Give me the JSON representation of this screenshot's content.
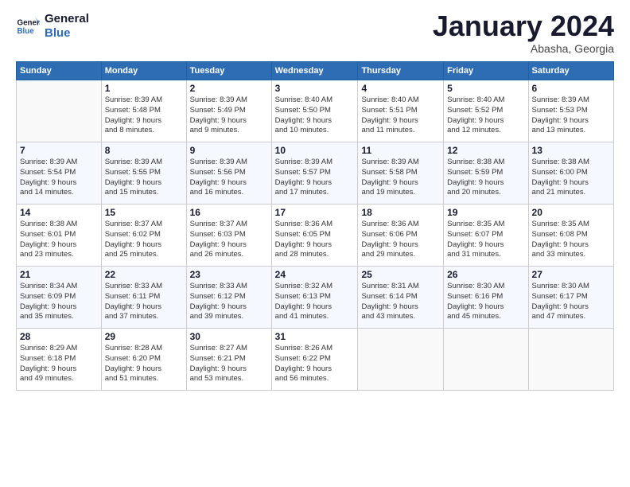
{
  "logo": {
    "line1": "General",
    "line2": "Blue"
  },
  "title": "January 2024",
  "subtitle": "Abasha, Georgia",
  "days_of_week": [
    "Sunday",
    "Monday",
    "Tuesday",
    "Wednesday",
    "Thursday",
    "Friday",
    "Saturday"
  ],
  "weeks": [
    [
      {
        "day": "",
        "info": ""
      },
      {
        "day": "1",
        "info": "Sunrise: 8:39 AM\nSunset: 5:48 PM\nDaylight: 9 hours\nand 8 minutes."
      },
      {
        "day": "2",
        "info": "Sunrise: 8:39 AM\nSunset: 5:49 PM\nDaylight: 9 hours\nand 9 minutes."
      },
      {
        "day": "3",
        "info": "Sunrise: 8:40 AM\nSunset: 5:50 PM\nDaylight: 9 hours\nand 10 minutes."
      },
      {
        "day": "4",
        "info": "Sunrise: 8:40 AM\nSunset: 5:51 PM\nDaylight: 9 hours\nand 11 minutes."
      },
      {
        "day": "5",
        "info": "Sunrise: 8:40 AM\nSunset: 5:52 PM\nDaylight: 9 hours\nand 12 minutes."
      },
      {
        "day": "6",
        "info": "Sunrise: 8:39 AM\nSunset: 5:53 PM\nDaylight: 9 hours\nand 13 minutes."
      }
    ],
    [
      {
        "day": "7",
        "info": "Sunrise: 8:39 AM\nSunset: 5:54 PM\nDaylight: 9 hours\nand 14 minutes."
      },
      {
        "day": "8",
        "info": "Sunrise: 8:39 AM\nSunset: 5:55 PM\nDaylight: 9 hours\nand 15 minutes."
      },
      {
        "day": "9",
        "info": "Sunrise: 8:39 AM\nSunset: 5:56 PM\nDaylight: 9 hours\nand 16 minutes."
      },
      {
        "day": "10",
        "info": "Sunrise: 8:39 AM\nSunset: 5:57 PM\nDaylight: 9 hours\nand 17 minutes."
      },
      {
        "day": "11",
        "info": "Sunrise: 8:39 AM\nSunset: 5:58 PM\nDaylight: 9 hours\nand 19 minutes."
      },
      {
        "day": "12",
        "info": "Sunrise: 8:38 AM\nSunset: 5:59 PM\nDaylight: 9 hours\nand 20 minutes."
      },
      {
        "day": "13",
        "info": "Sunrise: 8:38 AM\nSunset: 6:00 PM\nDaylight: 9 hours\nand 21 minutes."
      }
    ],
    [
      {
        "day": "14",
        "info": "Sunrise: 8:38 AM\nSunset: 6:01 PM\nDaylight: 9 hours\nand 23 minutes."
      },
      {
        "day": "15",
        "info": "Sunrise: 8:37 AM\nSunset: 6:02 PM\nDaylight: 9 hours\nand 25 minutes."
      },
      {
        "day": "16",
        "info": "Sunrise: 8:37 AM\nSunset: 6:03 PM\nDaylight: 9 hours\nand 26 minutes."
      },
      {
        "day": "17",
        "info": "Sunrise: 8:36 AM\nSunset: 6:05 PM\nDaylight: 9 hours\nand 28 minutes."
      },
      {
        "day": "18",
        "info": "Sunrise: 8:36 AM\nSunset: 6:06 PM\nDaylight: 9 hours\nand 29 minutes."
      },
      {
        "day": "19",
        "info": "Sunrise: 8:35 AM\nSunset: 6:07 PM\nDaylight: 9 hours\nand 31 minutes."
      },
      {
        "day": "20",
        "info": "Sunrise: 8:35 AM\nSunset: 6:08 PM\nDaylight: 9 hours\nand 33 minutes."
      }
    ],
    [
      {
        "day": "21",
        "info": "Sunrise: 8:34 AM\nSunset: 6:09 PM\nDaylight: 9 hours\nand 35 minutes."
      },
      {
        "day": "22",
        "info": "Sunrise: 8:33 AM\nSunset: 6:11 PM\nDaylight: 9 hours\nand 37 minutes."
      },
      {
        "day": "23",
        "info": "Sunrise: 8:33 AM\nSunset: 6:12 PM\nDaylight: 9 hours\nand 39 minutes."
      },
      {
        "day": "24",
        "info": "Sunrise: 8:32 AM\nSunset: 6:13 PM\nDaylight: 9 hours\nand 41 minutes."
      },
      {
        "day": "25",
        "info": "Sunrise: 8:31 AM\nSunset: 6:14 PM\nDaylight: 9 hours\nand 43 minutes."
      },
      {
        "day": "26",
        "info": "Sunrise: 8:30 AM\nSunset: 6:16 PM\nDaylight: 9 hours\nand 45 minutes."
      },
      {
        "day": "27",
        "info": "Sunrise: 8:30 AM\nSunset: 6:17 PM\nDaylight: 9 hours\nand 47 minutes."
      }
    ],
    [
      {
        "day": "28",
        "info": "Sunrise: 8:29 AM\nSunset: 6:18 PM\nDaylight: 9 hours\nand 49 minutes."
      },
      {
        "day": "29",
        "info": "Sunrise: 8:28 AM\nSunset: 6:20 PM\nDaylight: 9 hours\nand 51 minutes."
      },
      {
        "day": "30",
        "info": "Sunrise: 8:27 AM\nSunset: 6:21 PM\nDaylight: 9 hours\nand 53 minutes."
      },
      {
        "day": "31",
        "info": "Sunrise: 8:26 AM\nSunset: 6:22 PM\nDaylight: 9 hours\nand 56 minutes."
      },
      {
        "day": "",
        "info": ""
      },
      {
        "day": "",
        "info": ""
      },
      {
        "day": "",
        "info": ""
      }
    ]
  ]
}
